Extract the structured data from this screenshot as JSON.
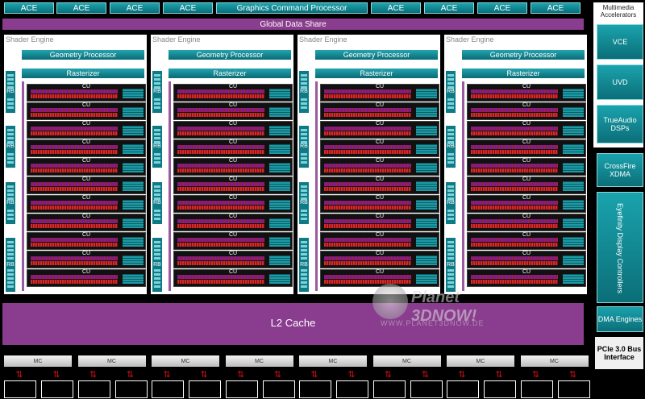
{
  "top": {
    "ace_label": "ACE",
    "gcp_label": "Graphics Command Processor",
    "gds_label": "Global Data Share"
  },
  "engine": {
    "title": "Shader Engine",
    "geometry": "Geometry Processor",
    "rasterizer": "Rasterizer",
    "rb": "RB",
    "cu": "CU"
  },
  "l2": "L2 Cache",
  "mc_label": "MC",
  "sidebar": {
    "multimedia_title": "Multimedia Accelerators",
    "vce": "VCE",
    "uvd": "UVD",
    "trueaudio": "TrueAudio DSPs",
    "crossfire": "CrossFire XDMA",
    "eyefinity": "Eyefinity Display Controllers",
    "dma": "DMA Engines",
    "pcie": "PCIe 3.0 Bus Interface"
  },
  "watermark": {
    "brand": "Planet 3DNOW!",
    "url": "WWW.PLANET3DNOW.DE"
  },
  "colors": {
    "teal": "#0b6e78",
    "purple": "#8a3c8f",
    "red": "#d01010"
  }
}
